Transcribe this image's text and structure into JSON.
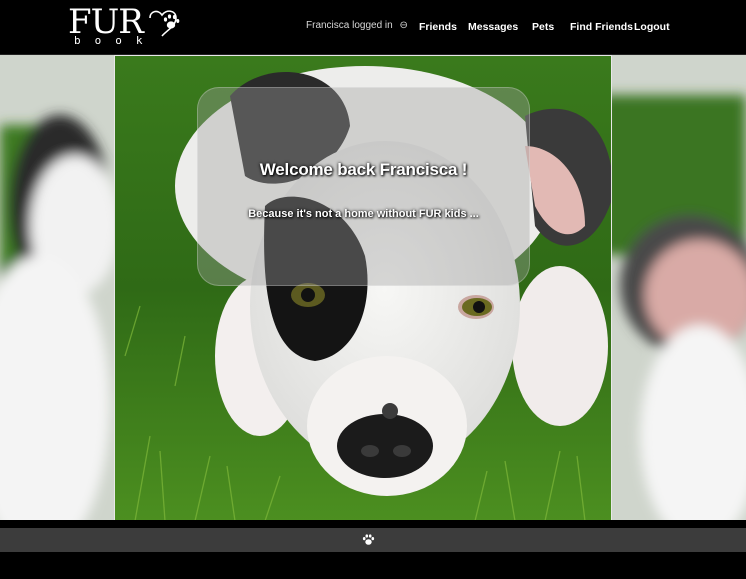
{
  "brand": {
    "name_top": "FUR",
    "name_bottom": "book",
    "logo_icon": "heart-paw-icon"
  },
  "nav": {
    "status": "Francisca logged in",
    "status_icon": "user-circle-icon",
    "links": [
      "Friends",
      "Messages",
      "Pets",
      "Find Friends",
      "Logout"
    ]
  },
  "hero": {
    "title": "Welcome back Francisca !",
    "subtitle": "Because it's not a home without FUR kids ..."
  },
  "footer": {
    "icon": "paw-icon"
  },
  "colors": {
    "navbar": "#000000",
    "footer": "#3c3c3c",
    "text": "#ffffff",
    "grass": "#3f7a1e"
  }
}
